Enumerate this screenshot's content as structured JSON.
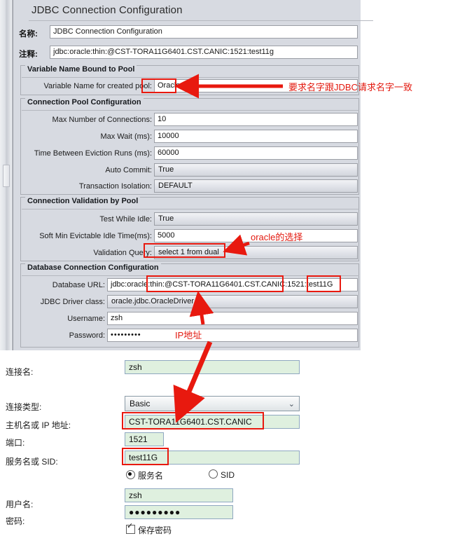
{
  "jmeter": {
    "panel_title": "JDBC Connection Configuration",
    "name_label": "名称:",
    "name_value": "JDBC Connection Configuration",
    "comment_label": "注释:",
    "comment_value": "jdbc:oracle:thin:@CST-TORA11G6401.CST.CANIC:1521:test11g",
    "groups": {
      "variable_name": {
        "title": "Variable Name Bound to Pool",
        "rows": [
          {
            "label": "Variable Name for created pool:",
            "value": "Oracle",
            "type": "text"
          }
        ]
      },
      "connection_pool": {
        "title": "Connection Pool Configuration",
        "rows": [
          {
            "label": "Max Number of Connections:",
            "value": "10",
            "type": "text"
          },
          {
            "label": "Max Wait (ms):",
            "value": "10000",
            "type": "text"
          },
          {
            "label": "Time Between Eviction Runs (ms):",
            "value": "60000",
            "type": "text"
          },
          {
            "label": "Auto Commit:",
            "value": "True",
            "type": "combo"
          },
          {
            "label": "Transaction Isolation:",
            "value": "DEFAULT",
            "type": "combo"
          }
        ]
      },
      "validation": {
        "title": "Connection Validation by Pool",
        "rows": [
          {
            "label": "Test While Idle:",
            "value": "True",
            "type": "combo"
          },
          {
            "label": "Soft Min Evictable Idle Time(ms):",
            "value": "5000",
            "type": "text"
          },
          {
            "label": "Validation Query:",
            "value": "select 1 from dual",
            "type": "combo"
          }
        ]
      },
      "database": {
        "title": "Database Connection Configuration",
        "rows": [
          {
            "label": "Database URL:",
            "value": "jdbc:oracle:thin:@CST-TORA11G6401.CST.CANIC:1521:test11G",
            "type": "text"
          },
          {
            "label": "JDBC Driver class:",
            "value": "oracle.jdbc.OracleDriver",
            "type": "combo"
          },
          {
            "label": "Username:",
            "value": "zsh",
            "type": "text"
          },
          {
            "label": "Password:",
            "value": "•••••••••",
            "type": "text"
          }
        ]
      }
    }
  },
  "annotations": {
    "variable_name_note": "要求名字跟JDBC请求名字一致",
    "validation_query_note": "oracle的选择",
    "ip_note": "IP地址",
    "accent_color": "#e8190f"
  },
  "sqldev": {
    "fields": {
      "conn_name_label": "连接名:",
      "conn_name_value": "zsh",
      "conn_type_label": "连接类型:",
      "conn_type_value": "Basic",
      "host_label": "主机名或 IP 地址:",
      "host_value": "CST-TORA11G6401.CST.CANIC",
      "port_label": "端口:",
      "port_value": "1521",
      "sid_label": "服务名或 SID:",
      "sid_value": "test11G",
      "username_label": "用户名:",
      "username_value": "zsh",
      "password_label": "密码:",
      "password_value": "●●●●●●●●●"
    },
    "radios": [
      {
        "label": "服务名",
        "selected": true
      },
      {
        "label": "SID",
        "selected": false
      }
    ],
    "checkbox": {
      "label": "保存密码",
      "checked": true
    }
  }
}
